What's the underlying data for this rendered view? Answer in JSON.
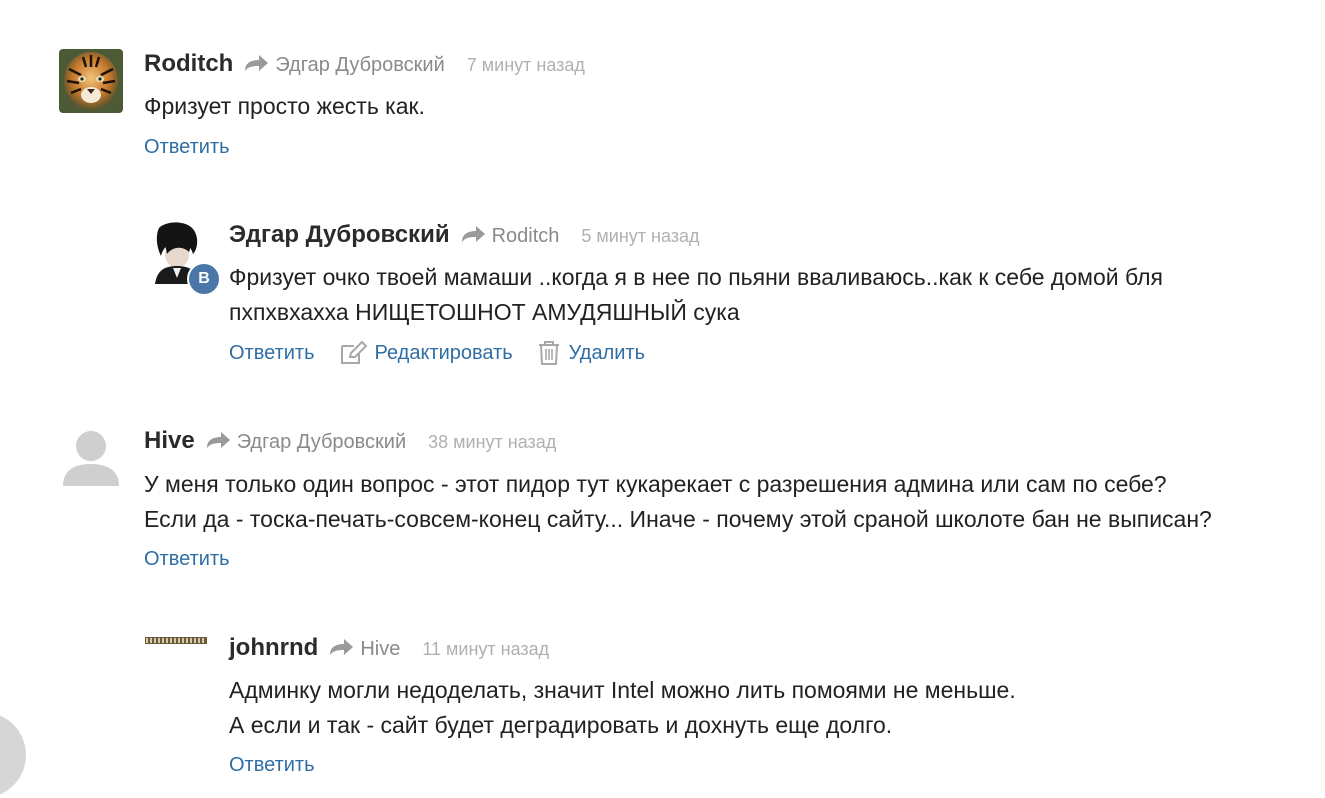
{
  "comments": [
    {
      "author": "Roditch",
      "reply_to": "Эдгар Дубровский",
      "time": "7 минут назад",
      "lines": [
        "Фризует просто жесть как."
      ],
      "actions": {
        "reply": "Ответить"
      }
    },
    {
      "author": "Эдгар Дубровский",
      "reply_to": "Roditch",
      "time": "5 минут назад",
      "badge": "В",
      "lines": [
        "Фризует очко твоей мамаши ..когда я в нее по пьяни вваливаюсь..как к себе  домой бля",
        "пхпхвхахха НИЩЕТОШНОТ АМУДЯШНЫЙ сука"
      ],
      "actions": {
        "reply": "Ответить",
        "edit": "Редактировать",
        "delete": "Удалить"
      }
    },
    {
      "author": "Hive",
      "reply_to": "Эдгар Дубровский",
      "time": "38 минут назад",
      "lines": [
        "У меня только один вопрос - этот пидор тут кукарекает с разрешения админа или сам по себе?",
        "Если да - тоска-печать-совсем-конец сайту... Иначе - почему этой сраной школоте бан не выписан?"
      ],
      "actions": {
        "reply": "Ответить"
      }
    },
    {
      "author": "johnrnd",
      "reply_to": "Hive",
      "time": "11 минут назад",
      "lines": [
        "Админку могли недоделать, значит Intel можно лить помоями не меньше.",
        "А если и так - сайт будет деградировать и дохнуть еще долго."
      ],
      "actions": {
        "reply": "Ответить"
      }
    }
  ],
  "colors": {
    "link": "#2f6ea5",
    "author": "#2b2b2b",
    "muted": "#8a8a8a",
    "time": "#b0b0b0",
    "vk_badge": "#4a76a8"
  },
  "icons": [
    "reply-arrow-icon",
    "edit-icon",
    "trash-icon",
    "vk-icon",
    "default-user-icon"
  ]
}
